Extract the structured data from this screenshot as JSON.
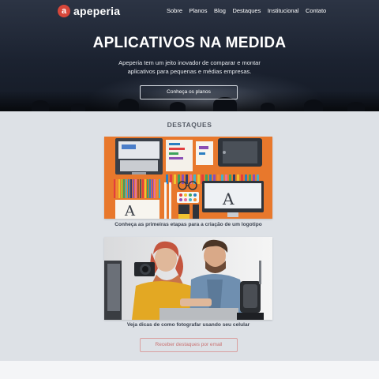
{
  "brand": {
    "logo_letter": "a",
    "name": "apeperia",
    "accent": "#d8473a"
  },
  "nav": [
    "Sobre",
    "Planos",
    "Blog",
    "Destaques",
    "Institucional",
    "Contato"
  ],
  "hero": {
    "title": "APLICATIVOS NA MEDIDA",
    "subtitle_line1": "Apeperia tem um jeito inovador de comparar e montar",
    "subtitle_line2": "aplicativos para pequenas e médias empresas.",
    "button": "Conheça os planos"
  },
  "highlights": {
    "title": "DESTAQUES",
    "cards": [
      {
        "caption": "Conheça as primeiras etapas para a criação de um logotipo",
        "image": "designer-desk-illustration"
      },
      {
        "caption": "Veja dicas de como fotografar usando seu celular",
        "image": "photographers-photo"
      }
    ],
    "email_button": "Receber destaques por email"
  }
}
